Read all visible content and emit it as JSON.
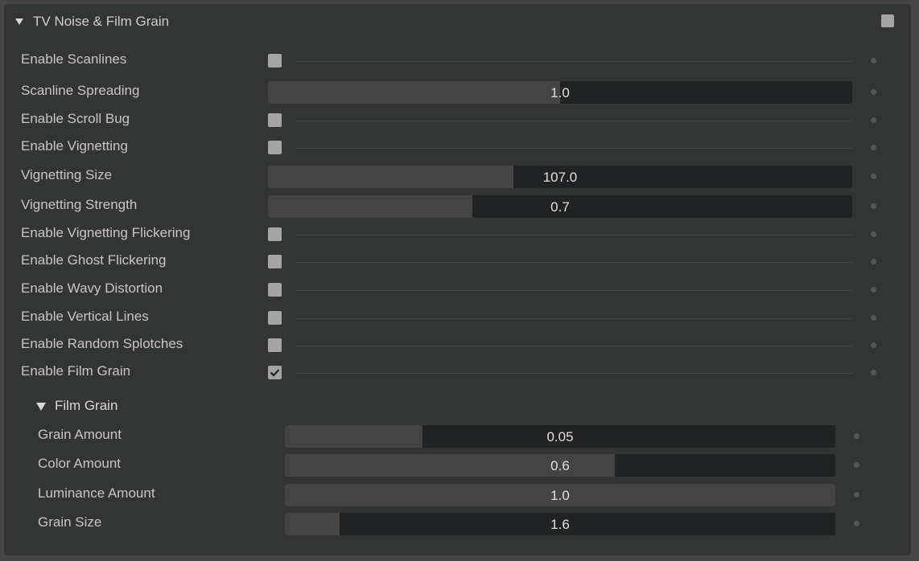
{
  "panel": {
    "title": "TV Noise & Film Grain",
    "expanded": true,
    "enabled": false
  },
  "rows": [
    {
      "label": "Enable Scanlines",
      "type": "checkbox",
      "checked": false
    },
    {
      "label": "Scanline Spreading",
      "type": "slider",
      "value": "1.0",
      "fraction": 0.5
    },
    {
      "label": "Enable Scroll Bug",
      "type": "checkbox",
      "checked": false
    },
    {
      "label": "Enable Vignetting",
      "type": "checkbox",
      "checked": false
    },
    {
      "label": "Vignetting Size",
      "type": "slider",
      "value": "107.0",
      "fraction": 0.42
    },
    {
      "label": "Vignetting Strength",
      "type": "slider",
      "value": "0.7",
      "fraction": 0.35
    },
    {
      "label": "Enable Vignetting Flickering",
      "type": "checkbox",
      "checked": false
    },
    {
      "label": "Enable Ghost Flickering",
      "type": "checkbox",
      "checked": false
    },
    {
      "label": "Enable Wavy Distortion",
      "type": "checkbox",
      "checked": false
    },
    {
      "label": "Enable Vertical Lines",
      "type": "checkbox",
      "checked": false
    },
    {
      "label": "Enable Random Splotches",
      "type": "checkbox",
      "checked": false
    },
    {
      "label": "Enable Film Grain",
      "type": "checkbox",
      "checked": true
    }
  ],
  "film_grain": {
    "title": "Film Grain",
    "expanded": true,
    "rows": [
      {
        "label": "Grain Amount",
        "type": "slider",
        "value": "0.05",
        "fraction": 0.25
      },
      {
        "label": "Color Amount",
        "type": "slider",
        "value": "0.6",
        "fraction": 0.6
      },
      {
        "label": "Luminance Amount",
        "type": "slider",
        "value": "1.0",
        "fraction": 1.0
      },
      {
        "label": "Grain Size",
        "type": "slider",
        "value": "1.6",
        "fraction": 0.1
      }
    ]
  },
  "colors": {
    "panel_bg": "#333534",
    "slider_track": "#212224",
    "slider_fill": "#444444",
    "checkbox": "#a4a4a4"
  }
}
